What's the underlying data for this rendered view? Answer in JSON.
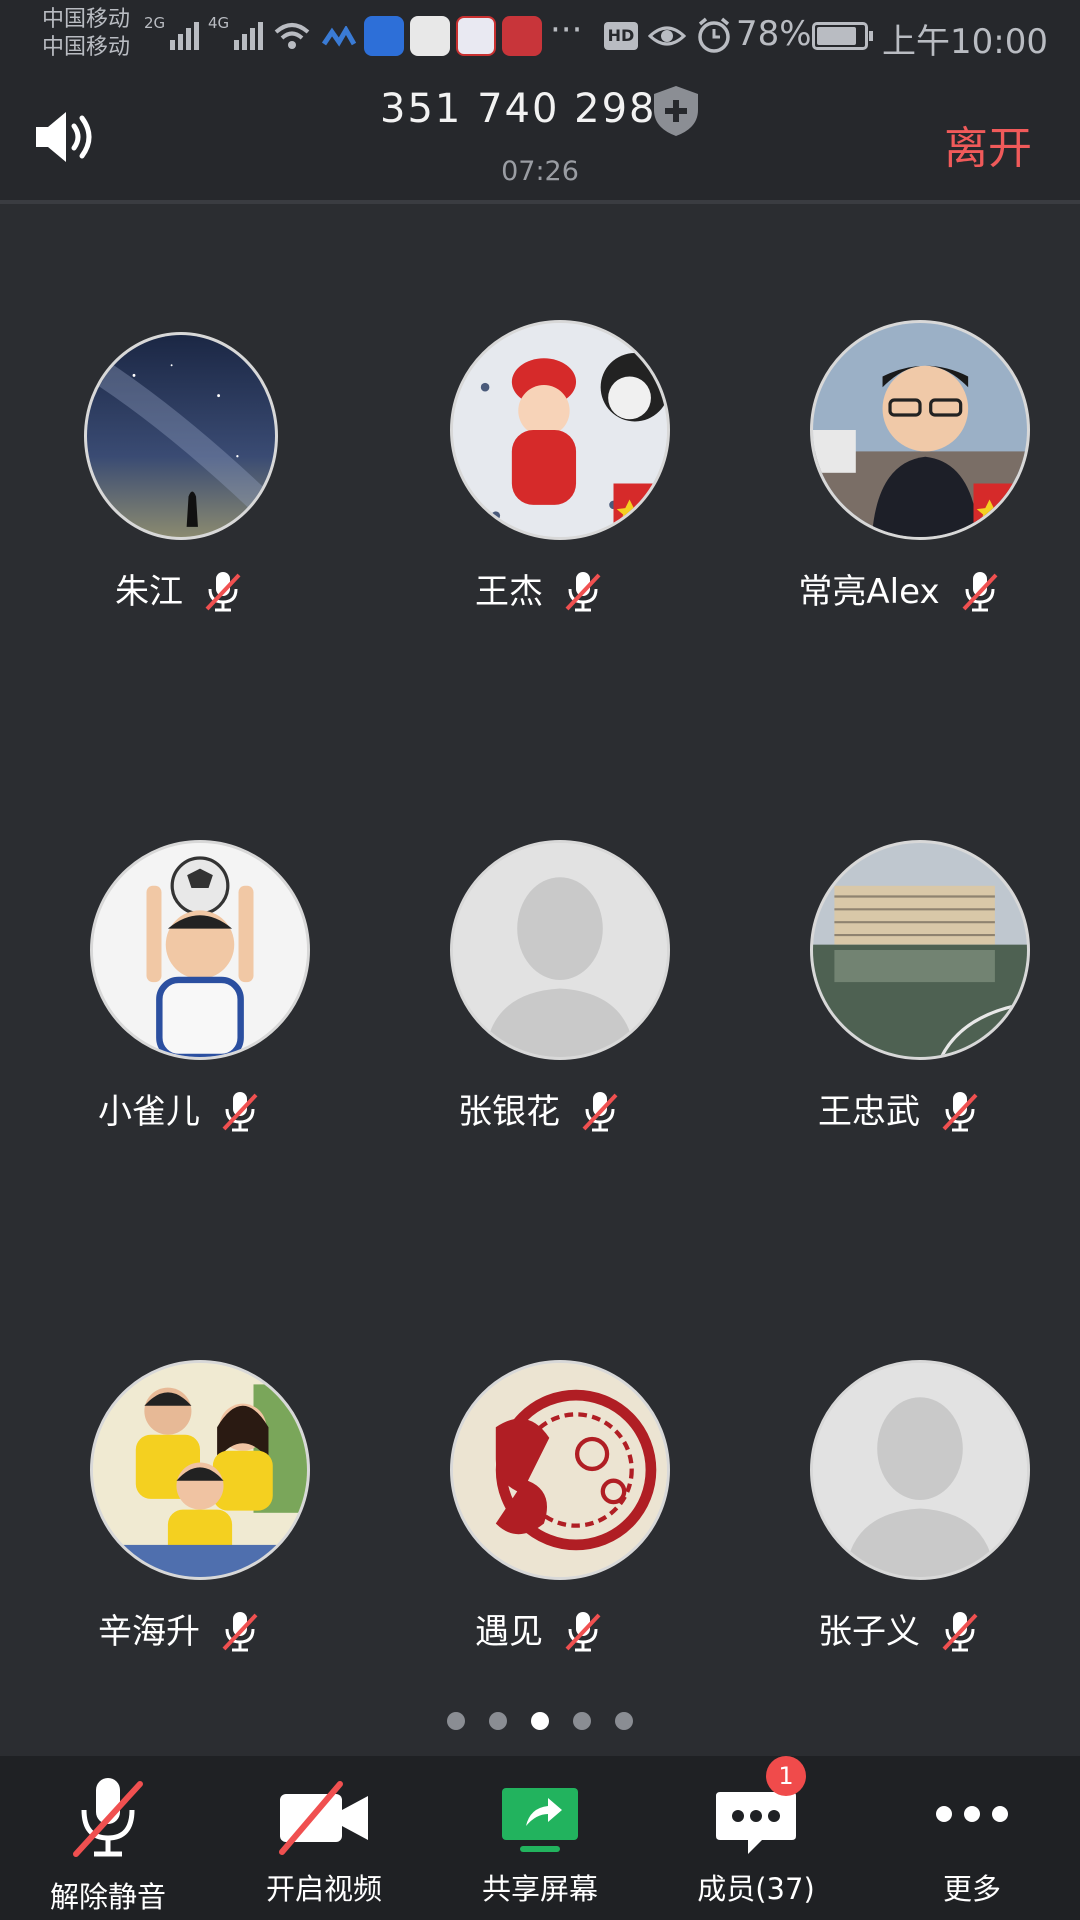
{
  "status_bar": {
    "carrier_1": "中国移动",
    "carrier_2": "中国移动",
    "sig1_label": "2G",
    "sig2_label": "4G",
    "more": "···",
    "hd": "HD",
    "battery": "78%",
    "time": "上午10:00"
  },
  "header": {
    "meeting_id": "351 740 298",
    "duration": "07:26",
    "leave": "离开"
  },
  "participants": [
    {
      "name": "朱江",
      "avatar": "starry-sky-photo",
      "muted": true
    },
    {
      "name": "王杰",
      "avatar": "baby-photo",
      "muted": true
    },
    {
      "name": "常亮Alex",
      "avatar": "man-glasses-photo",
      "muted": true
    },
    {
      "name": "小雀儿",
      "avatar": "child-soccer-photo",
      "muted": true
    },
    {
      "name": "张银花",
      "avatar": "default-avatar",
      "muted": true
    },
    {
      "name": "王忠武",
      "avatar": "building-photo",
      "muted": true
    },
    {
      "name": "辛海升",
      "avatar": "family-photo",
      "muted": true
    },
    {
      "name": "遇见",
      "avatar": "fu-character-art",
      "muted": true
    },
    {
      "name": "张子义",
      "avatar": "default-avatar",
      "muted": true
    }
  ],
  "pagination": {
    "pages": 5,
    "current": 3
  },
  "toolbar": {
    "unmute": "解除静音",
    "video": "开启视频",
    "share": "共享屏幕",
    "members": "成员(37)",
    "members_badge": "1",
    "more": "更多"
  },
  "colors": {
    "background": "#2b2d31",
    "leave": "#f05a5a",
    "share_green": "#22b35e",
    "badge": "#f04b4b"
  }
}
